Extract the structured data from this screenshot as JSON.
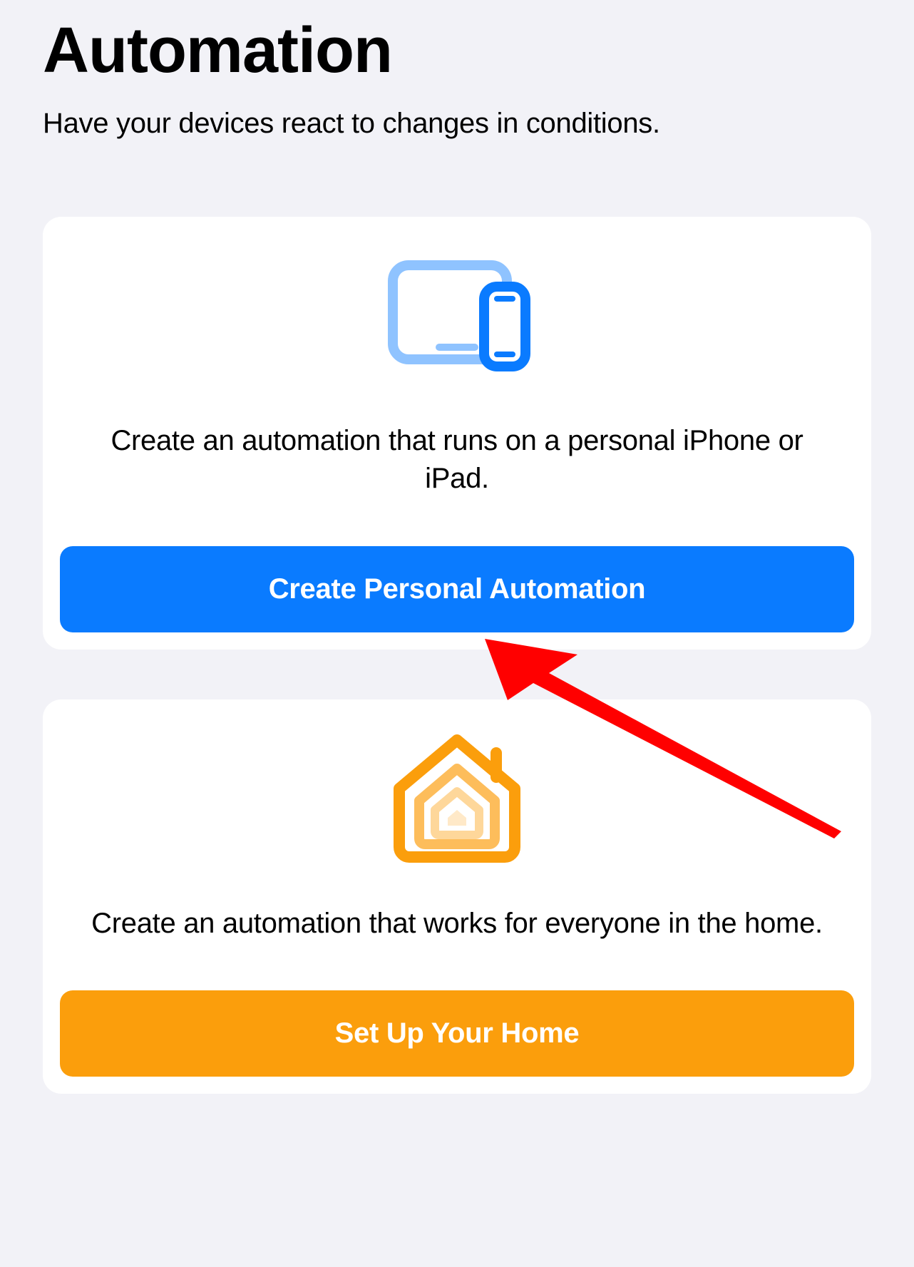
{
  "header": {
    "title": "Automation",
    "subtitle": "Have your devices react to changes in conditions."
  },
  "cards": {
    "personal": {
      "icon": "ipad-iphone-icon",
      "description": "Create an automation that runs on a personal iPhone or iPad.",
      "button_label": "Create Personal Automation",
      "button_color": "#0a7bff"
    },
    "home": {
      "icon": "home-icon",
      "description": "Create an automation that works for everyone in the home.",
      "button_label": "Set Up Your Home",
      "button_color": "#fb9e0c"
    }
  },
  "annotation": {
    "type": "red-arrow",
    "color": "#ff0000",
    "points_to": "create-personal-automation-button"
  }
}
